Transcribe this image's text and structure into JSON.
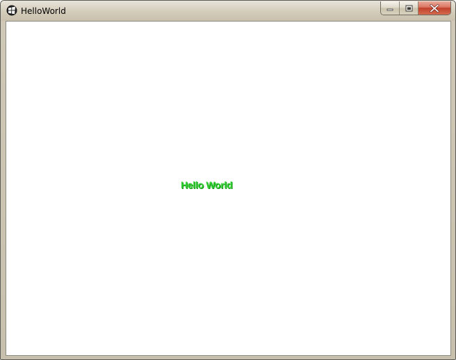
{
  "window": {
    "title": "HelloWorld",
    "icon": "app-icon"
  },
  "title_buttons": {
    "minimize_icon": "minimize-icon",
    "maximize_icon": "maximize-icon",
    "close_icon": "close-icon"
  },
  "content": {
    "message": "Hello World",
    "message_color": "#2fd12f"
  }
}
